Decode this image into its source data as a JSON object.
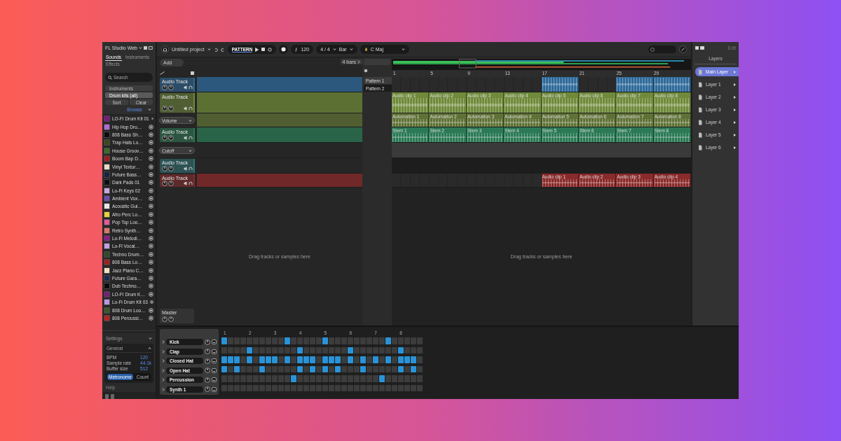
{
  "window": {
    "title": "FL Studio Web"
  },
  "sidebar": {
    "tabs": [
      {
        "label": "Sounds",
        "selected": true
      },
      {
        "label": "Instruments",
        "selected": false
      },
      {
        "label": "Effects",
        "selected": false
      }
    ],
    "search": {
      "placeholder": "Search"
    },
    "filters": [
      {
        "label": "Instruments",
        "selected": false
      },
      {
        "label": "Drum kits (all)",
        "selected": true
      }
    ],
    "buttons": [
      "Sort",
      "Clear"
    ],
    "browse_link": "Browse",
    "items": [
      {
        "name": "LO-FI Drum Kit 01",
        "color": "#7a1a7e"
      },
      {
        "name": "Hip Hop Dru…",
        "color": "#b06ad6"
      },
      {
        "name": "808 Bass Sh…",
        "color": "#0c0c0c"
      },
      {
        "name": "Trap Hats Lo…",
        "color": "#3a4a1f"
      },
      {
        "name": "House Groov…",
        "color": "#3c6a2a"
      },
      {
        "name": "Boom Bap D…",
        "color": "#9a1d1d"
      },
      {
        "name": "Vinyl Textur…",
        "color": "#e7dcc8"
      },
      {
        "name": "Future Bass…",
        "color": "#16233f"
      },
      {
        "name": "Dark Pads 01",
        "color": "#0d0d14"
      },
      {
        "name": "Lo-Fi Keys 02",
        "color": "#c9a6e0"
      },
      {
        "name": "Ambient Vox…",
        "color": "#6c4db0"
      },
      {
        "name": "Acoustic Gui…",
        "color": "#e8e8e8"
      },
      {
        "name": "Afro Perc Lo…",
        "color": "#e6d23a"
      },
      {
        "name": "Pop Top Loo…",
        "color": "#e05a9a"
      },
      {
        "name": "Retro Synth…",
        "color": "#d9766a"
      },
      {
        "name": "Lo-Fi Melodi…",
        "color": "#8a1c8c"
      },
      {
        "name": "Lo-Fi Vocal…",
        "color": "#c2a0e4"
      },
      {
        "name": "Techno Drum…",
        "color": "#2f4a2a"
      },
      {
        "name": "808 Bass Lo…",
        "color": "#a32020"
      },
      {
        "name": "Jazz Piano C…",
        "color": "#efe0c0"
      },
      {
        "name": "Future Gara…",
        "color": "#1a2a4f"
      },
      {
        "name": "Dub Techno…",
        "color": "#0a0a0a"
      },
      {
        "name": "LO-FI Drum K…",
        "color": "#76207a"
      },
      {
        "name": "Lo-Fi Drum Kit 03",
        "color": "#b898e0"
      },
      {
        "name": "808 Drum Loo…",
        "color": "#3a5a2a"
      },
      {
        "name": "808 Percussi…",
        "color": "#b02424"
      }
    ]
  },
  "settings": {
    "title": "Settings",
    "section": "General",
    "fields": [
      {
        "label": "BPM",
        "value": "120"
      },
      {
        "label": "Sample rate",
        "value": "44.1k"
      },
      {
        "label": "Buffer size",
        "value": "512"
      }
    ],
    "buttons": [
      {
        "label": "Metronome",
        "selected": true
      },
      {
        "label": "Count",
        "selected": false
      }
    ],
    "footer": "Help"
  },
  "toolbar": {
    "project": "Untitled project",
    "mode": "PATTERN",
    "tempo": "120",
    "time_signature": "4 / 4",
    "grid": "Bar",
    "key": "C Maj"
  },
  "arrange": {
    "add_button": "Add",
    "length_chip": "4 bars",
    "patterns": [
      {
        "label": "Pattern 1",
        "selected": false
      },
      {
        "label": "Pattern 2",
        "selected": true
      }
    ],
    "ruler": [
      "1",
      "5",
      "9",
      "13",
      "17",
      "21",
      "25",
      "29"
    ],
    "hints": [
      "Drag tracks or samples here",
      "Drag tracks or samples here"
    ],
    "master": "Master"
  },
  "tracks": [
    {
      "kind": "audio",
      "name": "Audio Track",
      "color": "#2e6a9a",
      "pattern": true,
      "clips": [
        {
          "kind": "empty"
        },
        {
          "kind": "empty"
        },
        {
          "kind": "empty"
        },
        {
          "kind": "empty"
        },
        {
          "kind": "clip"
        },
        {
          "kind": "empty"
        },
        {
          "kind": "clip"
        },
        {
          "kind": "clip"
        }
      ]
    },
    {
      "kind": "audio",
      "name": "Audio Track",
      "color": "#6f8a3a",
      "pattern": true,
      "clips": [
        {
          "kind": "clip",
          "label": "Audio clip 1"
        },
        {
          "kind": "clip",
          "label": "Audio clip 2"
        },
        {
          "kind": "clip",
          "label": "Audio clip 3"
        },
        {
          "kind": "clip",
          "label": "Audio clip 4"
        },
        {
          "kind": "clip",
          "label": "Audio clip 5"
        },
        {
          "kind": "clip",
          "label": "Audio clip 6"
        },
        {
          "kind": "clip",
          "label": "Audio clip 7"
        },
        {
          "kind": "clip",
          "label": "Audio clip 8"
        }
      ]
    },
    {
      "kind": "automation",
      "name": "Volume",
      "color": "#5f7236",
      "pattern": true,
      "clips": [
        {
          "kind": "clip",
          "label": "Automation 1"
        },
        {
          "kind": "clip",
          "label": "Automation 2"
        },
        {
          "kind": "clip",
          "label": "Automation 3"
        },
        {
          "kind": "clip",
          "label": "Automation 4"
        },
        {
          "kind": "clip",
          "label": "Automation 5"
        },
        {
          "kind": "clip",
          "label": "Automation 6"
        },
        {
          "kind": "clip",
          "label": "Automation 7"
        },
        {
          "kind": "clip",
          "label": "Automation 8"
        }
      ]
    },
    {
      "kind": "audio",
      "name": "Audio Track",
      "color": "#2b7a55",
      "pattern": true,
      "clips": [
        {
          "kind": "clip",
          "label": "Stem 1"
        },
        {
          "kind": "clip",
          "label": "Stem 2"
        },
        {
          "kind": "clip",
          "label": "Stem 3"
        },
        {
          "kind": "clip",
          "label": "Stem 4"
        },
        {
          "kind": "clip",
          "label": "Stem 5"
        },
        {
          "kind": "clip",
          "label": "Stem 6"
        },
        {
          "kind": "clip",
          "label": "Stem 7"
        },
        {
          "kind": "clip",
          "label": "Stem 8"
        }
      ]
    },
    {
      "kind": "automation",
      "name": "Cutoff",
      "pattern": false
    },
    {
      "kind": "audio",
      "name": "Audio Track",
      "color": "#2e7377",
      "pattern": false
    },
    {
      "kind": "audio",
      "name": "Audio Track",
      "color": "#8a2a2a",
      "pattern": true,
      "clips": [
        {
          "kind": "empty"
        },
        {
          "kind": "empty"
        },
        {
          "kind": "empty"
        },
        {
          "kind": "empty"
        },
        {
          "kind": "clip",
          "label": "Audio clip 1"
        },
        {
          "kind": "clip",
          "label": "Audio clip 2"
        },
        {
          "kind": "clip",
          "label": "Audio clip 3"
        },
        {
          "kind": "clip",
          "label": "Audio clip 4"
        }
      ]
    }
  ],
  "layers": {
    "edit": "Edit",
    "title": "Layers",
    "items": [
      {
        "label": "Main Layer",
        "selected": true
      },
      {
        "label": "Layer 1",
        "selected": false
      },
      {
        "label": "Layer 2",
        "selected": false
      },
      {
        "label": "Layer 3",
        "selected": false
      },
      {
        "label": "Layer 4",
        "selected": false
      },
      {
        "label": "Layer 5",
        "selected": false
      },
      {
        "label": "Layer 6",
        "selected": false
      }
    ]
  },
  "sequencer": {
    "beats": [
      "1",
      "2",
      "3",
      "4",
      "5",
      "6",
      "7",
      "8"
    ],
    "rows": [
      {
        "name": "Kick",
        "steps": [
          true,
          false,
          false,
          false,
          false,
          false,
          false,
          false,
          false,
          false,
          true,
          false,
          false,
          false,
          false,
          false,
          true,
          false,
          false,
          false,
          false,
          false,
          false,
          false,
          false,
          false,
          true,
          false,
          false,
          false,
          false,
          false
        ]
      },
      {
        "name": "Clap",
        "steps": [
          false,
          false,
          false,
          false,
          true,
          false,
          false,
          false,
          false,
          false,
          false,
          false,
          true,
          false,
          false,
          false,
          false,
          false,
          false,
          false,
          true,
          false,
          false,
          false,
          false,
          false,
          false,
          false,
          true,
          false,
          false,
          false
        ]
      },
      {
        "name": "Closed Hat",
        "steps": [
          true,
          true,
          true,
          false,
          true,
          false,
          true,
          true,
          true,
          false,
          true,
          false,
          true,
          true,
          true,
          false,
          true,
          true,
          true,
          false,
          true,
          false,
          true,
          false,
          true,
          false,
          true,
          false,
          true,
          true,
          true,
          false
        ]
      },
      {
        "name": "Open Hat",
        "steps": [
          true,
          false,
          true,
          false,
          false,
          false,
          true,
          false,
          false,
          false,
          false,
          false,
          true,
          false,
          true,
          false,
          true,
          false,
          true,
          false,
          false,
          false,
          true,
          false,
          false,
          false,
          false,
          false,
          true,
          false,
          true,
          false
        ]
      },
      {
        "name": "Percussion",
        "steps": [
          false,
          false,
          false,
          false,
          false,
          false,
          false,
          false,
          false,
          false,
          false,
          true,
          false,
          false,
          false,
          false,
          false,
          false,
          false,
          false,
          false,
          false,
          false,
          false,
          false,
          true,
          false,
          false,
          false,
          false,
          false,
          false
        ]
      },
      {
        "name": "Synth 1",
        "steps": [
          false,
          false,
          false,
          false,
          false,
          false,
          false,
          false,
          false,
          false,
          false,
          false,
          false,
          false,
          false,
          false,
          false,
          false,
          false,
          false,
          false,
          false,
          false,
          false,
          false,
          false,
          false,
          false,
          false,
          false,
          false,
          false
        ]
      }
    ]
  }
}
